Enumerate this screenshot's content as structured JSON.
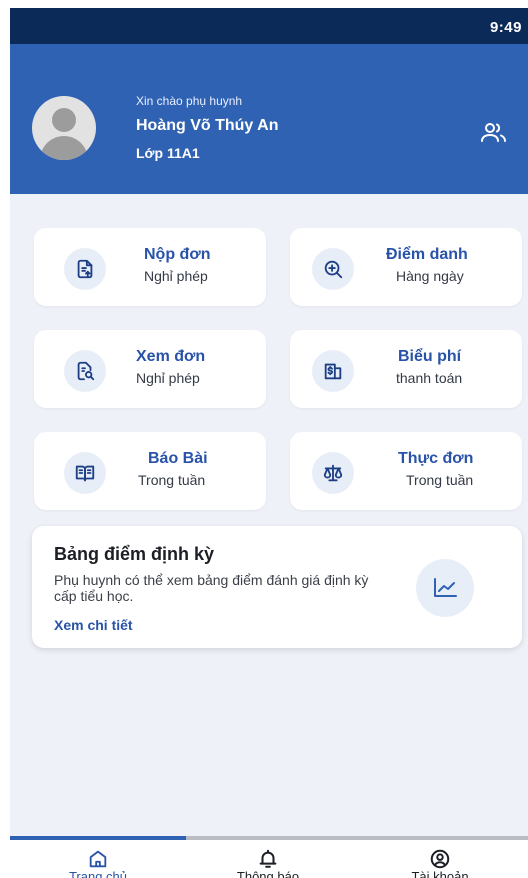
{
  "status_bar": {
    "time": "9:49"
  },
  "header": {
    "greeting": "Xin chào phụ huynh",
    "parent_name": "Hoàng Võ Thúy An",
    "class_name": "Lớp 11A1",
    "switch_icon": "users-icon"
  },
  "features": [
    {
      "title": "Nộp đơn",
      "subtitle": "Nghỉ phép",
      "icon": "file-upload-icon"
    },
    {
      "title": "Điểm danh",
      "subtitle": "Hàng ngày",
      "icon": "zoom-in-icon"
    },
    {
      "title": "Xem đơn",
      "subtitle": "Nghỉ phép",
      "icon": "file-search-icon"
    },
    {
      "title": "Biểu phí",
      "subtitle": "thanh toán",
      "icon": "receipt-dollar-icon"
    },
    {
      "title": "Báo Bài",
      "subtitle": "Trong tuần",
      "icon": "book-open-icon"
    },
    {
      "title": "Thực đơn",
      "subtitle": "Trong tuần",
      "icon": "scale-icon"
    }
  ],
  "score_card": {
    "title": "Bảng điểm định kỳ",
    "description": "Phụ huynh có thể xem bảng điểm đánh giá định kỳ cấp tiểu học.",
    "link": "Xem chi tiết",
    "icon": "chart-line-icon"
  },
  "bottom_nav": [
    {
      "label": "Trang chủ",
      "icon": "home-icon",
      "active": true
    },
    {
      "label": "Thông báo",
      "icon": "bell-icon",
      "active": false
    },
    {
      "label": "Tài khoản",
      "icon": "user-circle-icon",
      "active": false
    }
  ],
  "colors": {
    "primary": "#2f62b3",
    "accent_text": "#2953a8",
    "background": "#eef1f7",
    "status_bar": "#0b2a58"
  }
}
